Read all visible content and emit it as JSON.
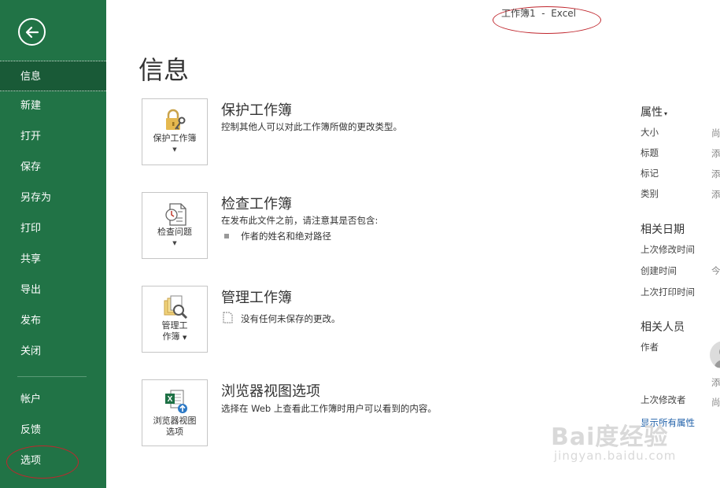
{
  "window": {
    "title": "工作簿1  -  Excel"
  },
  "sidebar": {
    "items": [
      {
        "label": "信息"
      },
      {
        "label": "新建"
      },
      {
        "label": "打开"
      },
      {
        "label": "保存"
      },
      {
        "label": "另存为"
      },
      {
        "label": "打印"
      },
      {
        "label": "共享"
      },
      {
        "label": "导出"
      },
      {
        "label": "发布"
      },
      {
        "label": "关闭"
      },
      {
        "label": "帐户"
      },
      {
        "label": "反馈"
      },
      {
        "label": "选项"
      }
    ]
  },
  "main": {
    "title": "信息",
    "sections": [
      {
        "button_label": "保护工作簿",
        "title": "保护工作簿",
        "description": "控制其他人可以对此工作簿所做的更改类型。"
      },
      {
        "button_label": "检查问题",
        "title": "检查工作簿",
        "description": "在发布此文件之前，请注意其是否包含:",
        "bullet": "作者的姓名和绝对路径"
      },
      {
        "button_label_line1": "管理工",
        "button_label_line2": "作簿",
        "title": "管理工作簿",
        "description": "没有任何未保存的更改。"
      },
      {
        "button_label_line1": "浏览器视图",
        "button_label_line2": "选项",
        "title": "浏览器视图选项",
        "description": "选择在 Web 上查看此工作簿时用户可以看到的内容。"
      }
    ]
  },
  "properties": {
    "heading": "属性",
    "items": [
      {
        "label": "大小",
        "value": "尚"
      },
      {
        "label": "标题",
        "value": "添"
      },
      {
        "label": "标记",
        "value": "添"
      },
      {
        "label": "类别",
        "value": "添"
      }
    ],
    "dates_heading": "相关日期",
    "dates": [
      {
        "label": "上次修改时间",
        "value": ""
      },
      {
        "label": "创建时间",
        "value": "今"
      },
      {
        "label": "上次打印时间",
        "value": ""
      }
    ],
    "people_heading": "相关人员",
    "author_label": "作者",
    "author_value": "添",
    "last_modified_by_label": "上次修改者",
    "last_modified_by_value": "尚",
    "show_all_link": "显示所有属性"
  },
  "watermark": {
    "main": "Bai度经验",
    "sub": "jingyan.baidu.com"
  },
  "colors": {
    "sidebar": "#217346",
    "sidebar_active": "#195a37",
    "link": "#1e5fa8",
    "annotation": "#c0262d"
  }
}
